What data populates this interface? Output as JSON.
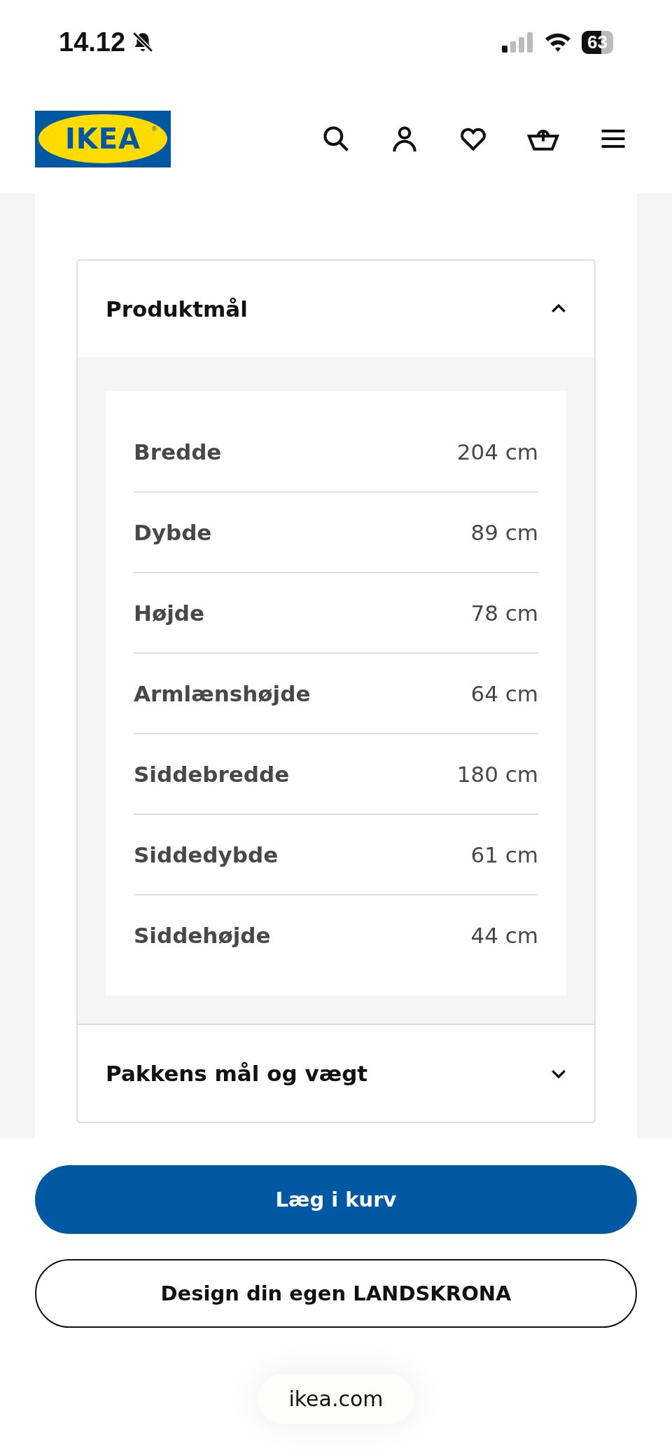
{
  "status_bar": {
    "time": "14.12",
    "battery": "63"
  },
  "header": {
    "logo": "IKEA",
    "logo_mark": "®"
  },
  "accordions": [
    {
      "title": "Produktmål",
      "expanded": true,
      "rows": [
        {
          "label": "Bredde",
          "value": "204 cm"
        },
        {
          "label": "Dybde",
          "value": "89 cm"
        },
        {
          "label": "Højde",
          "value": "78 cm"
        },
        {
          "label": "Armlænshøjde",
          "value": "64 cm"
        },
        {
          "label": "Siddebredde",
          "value": "180 cm"
        },
        {
          "label": "Siddedybde",
          "value": "61 cm"
        },
        {
          "label": "Siddehøjde",
          "value": "44 cm"
        }
      ]
    },
    {
      "title": "Pakkens mål og vægt",
      "expanded": false
    }
  ],
  "buttons": [
    {
      "label": "Læg i kurv",
      "kind": "primary"
    },
    {
      "label": "Design din egen LANDSKRONA",
      "kind": "secondary"
    }
  ],
  "url_bar": {
    "address": "ikea.com"
  }
}
